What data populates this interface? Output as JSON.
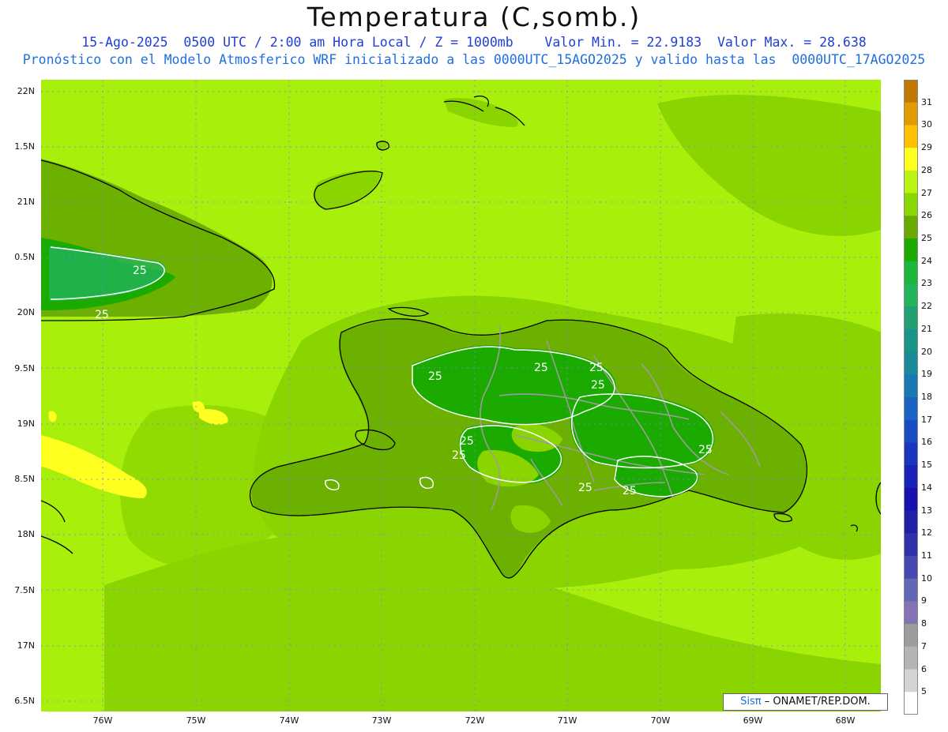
{
  "title": "Temperatura (C,somb.)",
  "subtitle1": "15-Ago-2025  0500 UTC / 2:00 am Hora Local / Z = 1000mb    Valor Min. = 22.9183  Valor Max. = 28.638",
  "subtitle2": "Pronóstico con el Modelo Atmosferico WRF inicializado a las 0000UTC_15AGO2025 y valido hasta las  0000UTC_17AGO2025",
  "lat_labels": [
    "22N",
    "1.5N",
    "21N",
    "0.5N",
    "20N",
    "9.5N",
    "19N",
    "8.5N",
    "18N",
    "7.5N",
    "17N",
    "6.5N"
  ],
  "lon_labels": [
    "76W",
    "75W",
    "74W",
    "73W",
    "72W",
    "71W",
    "70W",
    "69W",
    "68W"
  ],
  "colorbar": {
    "labels": [
      "31",
      "30",
      "29",
      "28",
      "27",
      "26",
      "25",
      "24",
      "23",
      "22",
      "21",
      "20",
      "19",
      "18",
      "17",
      "16",
      "15",
      "14",
      "13",
      "12",
      "11",
      "10",
      "9",
      "8",
      "7",
      "6",
      "5"
    ],
    "colors": [
      "#c07800",
      "#e29a00",
      "#ffc000",
      "#ffff20",
      "#b8f510",
      "#8ad800",
      "#6aaa00",
      "#1aaa00",
      "#1ab83a",
      "#22b45a",
      "#22a072",
      "#1a9488",
      "#1a8a9a",
      "#1a78b4",
      "#1a64c4",
      "#1a4cc4",
      "#1a36c0",
      "#1a22b8",
      "#1a10b0",
      "#2020a8",
      "#3030a8",
      "#4848b0",
      "#6468b4",
      "#8474b4",
      "#9c9c9c",
      "#b4b4b4",
      "#d4d4d4",
      "#ffffff"
    ]
  },
  "contour_labels": [
    "25",
    "25",
    "25",
    "25",
    "25",
    "25",
    "25",
    "25",
    "25",
    "25",
    "25"
  ],
  "credit": {
    "sis": "Sisπ",
    "org": "– ONAMET/REP.DOM."
  },
  "colors": {
    "ocean": "#a8ef0c",
    "land_low": "#8ad400",
    "land_mid": "#6cb000",
    "land_high": "#22b000",
    "yellow": "#ffff20",
    "title_blue": "#1f3fd8"
  }
}
